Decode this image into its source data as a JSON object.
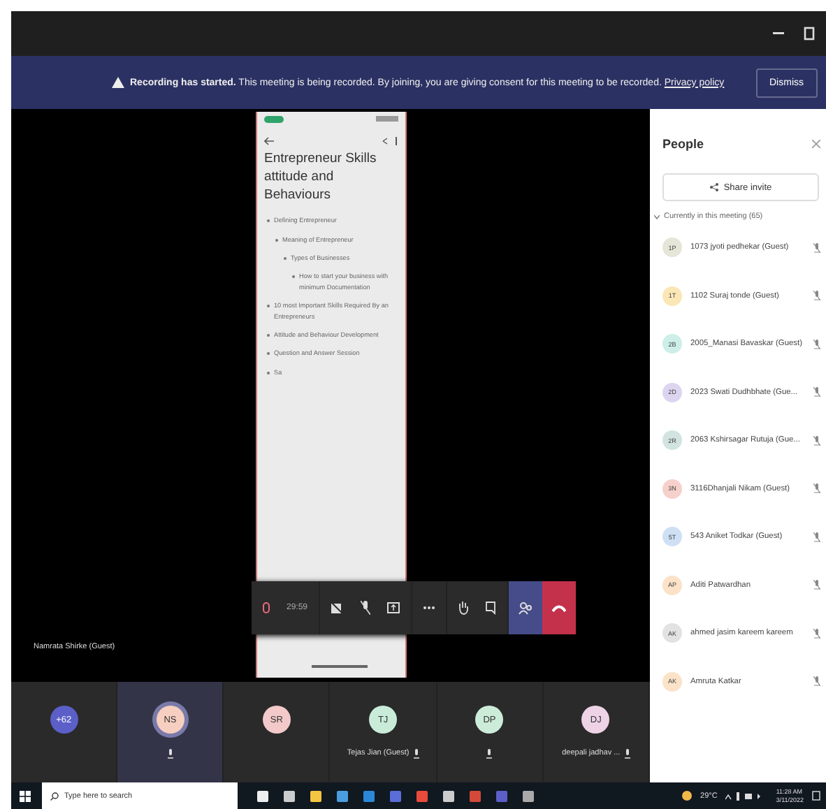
{
  "banner": {
    "title": "Recording has started.",
    "message": "This meeting is being recorded. By joining, you are giving consent for this meeting to be recorded.",
    "link": "Privacy policy",
    "button": "Dismiss"
  },
  "shared_screen": {
    "title": "Entrepreneur Skills attitude and Behaviours",
    "outline": [
      {
        "text": "Defining Entrepreneur",
        "children": [
          {
            "text": "Meaning of Entrepreneur",
            "children": [
              {
                "text": "Types of Businesses",
                "children": [
                  {
                    "text": "How to start your business with minimum Documentation"
                  }
                ]
              }
            ]
          }
        ]
      },
      {
        "text": "10 most Important Skills Required By an Entrepreneurs"
      },
      {
        "text": "Attitude and Behaviour Development"
      },
      {
        "text": "Question and Answer Session"
      },
      {
        "text": "Sa"
      }
    ]
  },
  "presenter": "Namrata Shirke (Guest)",
  "toolbar": {
    "timer": "29:59"
  },
  "tiles": [
    {
      "initials": "+62",
      "color": "#5b5fc7",
      "muted": false,
      "speaking": false
    },
    {
      "initials": "NS",
      "color": "#f7cfc0",
      "muted": true,
      "speaking": true
    },
    {
      "initials": "SR",
      "color": "#f3c9c9",
      "muted": false,
      "speaking": false
    },
    {
      "initials": "TJ",
      "color": "#c9ecd9",
      "muted": true,
      "speaking": false,
      "name": "Tejas Jian (Guest)"
    },
    {
      "initials": "DP",
      "color": "#cdebd9",
      "muted": true,
      "speaking": false
    },
    {
      "initials": "DJ",
      "color": "#eed3e6",
      "muted": true,
      "speaking": false,
      "name": "deepali jadhav ..."
    }
  ],
  "people": {
    "title": "People",
    "share": "Share invite",
    "section": "Currently in this meeting (65)",
    "items": [
      {
        "initials": "1P",
        "color": "#e6e6d8",
        "name": "1073 jyoti pedhekar (Guest)"
      },
      {
        "initials": "1T",
        "color": "#fbe7b6",
        "name": "1102 Suraj tonde (Guest)"
      },
      {
        "initials": "2B",
        "color": "#cdeee9",
        "name": "2005_Manasi Bavaskar (Guest)"
      },
      {
        "initials": "2D",
        "color": "#ddd5f0",
        "name": "2023 Swati Dudhbhate (Gue..."
      },
      {
        "initials": "2R",
        "color": "#d2e4e0",
        "name": "2063 Kshirsagar Rutuja (Gue..."
      },
      {
        "initials": "3N",
        "color": "#f6d0ca",
        "name": "3116Dhanjali Nikam (Guest)"
      },
      {
        "initials": "5T",
        "color": "#cfe0f5",
        "name": "543 Aniket Todkar (Guest)"
      },
      {
        "initials": "AP",
        "color": "#fbe2c8",
        "name": "Aditi Patwardhan"
      },
      {
        "initials": "AK",
        "color": "#e2e2e2",
        "name": "ahmed jasim kareem kareem"
      },
      {
        "initials": "AK",
        "color": "#fbe3c9",
        "name": "Amruta Katkar"
      }
    ]
  },
  "taskbar": {
    "search_placeholder": "Type here to search",
    "weather": "29°C",
    "time": "11:28 AM",
    "date": "3/11/2022"
  }
}
